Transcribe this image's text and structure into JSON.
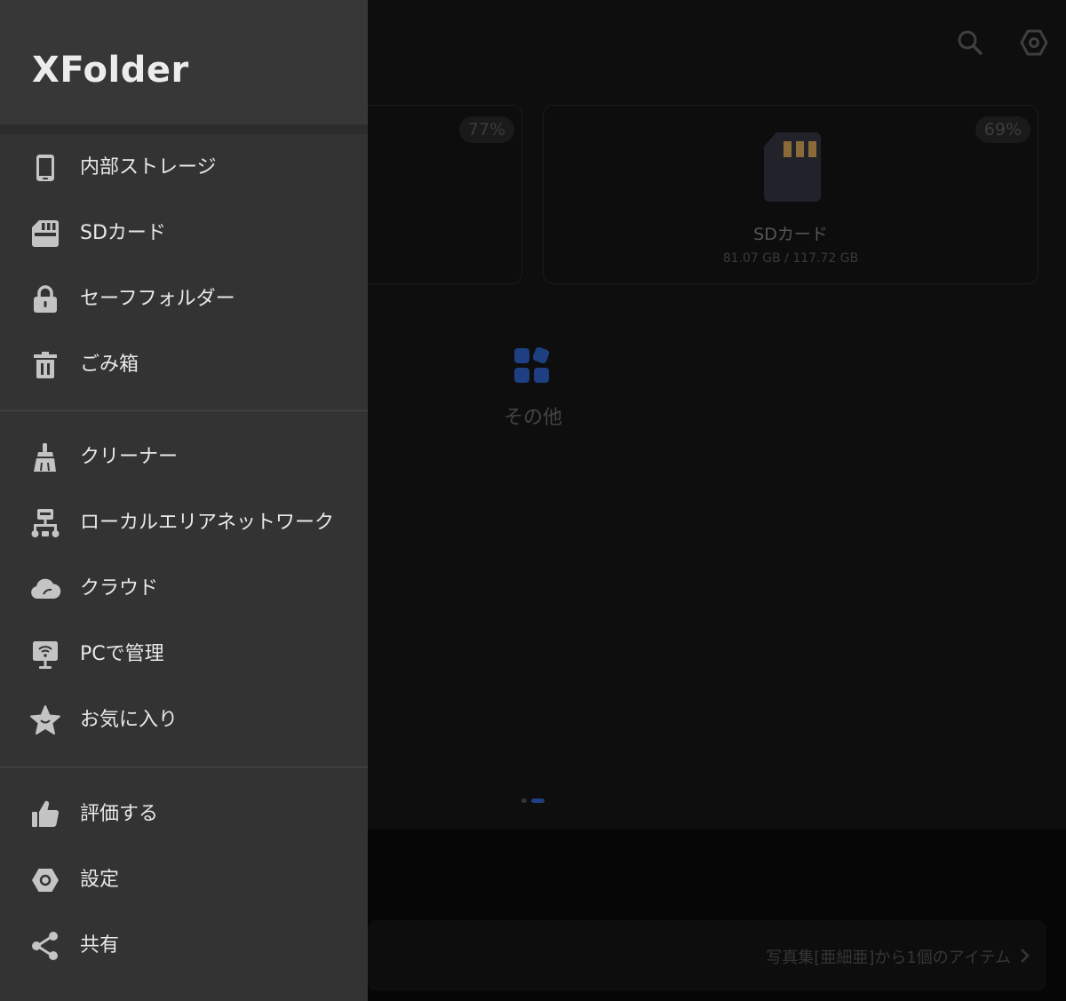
{
  "drawer": {
    "brand": "XFolder",
    "sections": [
      [
        {
          "label": "内部ストレージ",
          "icon": "phone-icon"
        },
        {
          "label": "SDカード",
          "icon": "sd-card-icon"
        },
        {
          "label": "セーフフォルダー",
          "icon": "lock-icon"
        },
        {
          "label": "ごみ箱",
          "icon": "trash-icon"
        }
      ],
      [
        {
          "label": "クリーナー",
          "icon": "broom-icon"
        },
        {
          "label": "ローカルエリアネットワーク",
          "icon": "network-icon"
        },
        {
          "label": "クラウド",
          "icon": "cloud-icon"
        },
        {
          "label": "PCで管理",
          "icon": "pc-wifi-icon"
        },
        {
          "label": "お気に入り",
          "icon": "star-icon"
        }
      ],
      [
        {
          "label": "評価する",
          "icon": "thumbs-up-icon"
        },
        {
          "label": "設定",
          "icon": "settings-icon"
        },
        {
          "label": "共有",
          "icon": "share-icon"
        }
      ]
    ]
  },
  "background": {
    "storage_cards": [
      {
        "percent": "77%"
      },
      {
        "percent": "69%",
        "title": "SDカード",
        "usage": "81.07 GB / 117.72 GB"
      }
    ],
    "other_label": "その他",
    "recent_text": "写真集[亜細亜]から1個のアイテム",
    "colors": {
      "accent": "#1e4fa8",
      "sd_contacts": "#8b6a3a",
      "drawer_bg": "#333333"
    }
  }
}
